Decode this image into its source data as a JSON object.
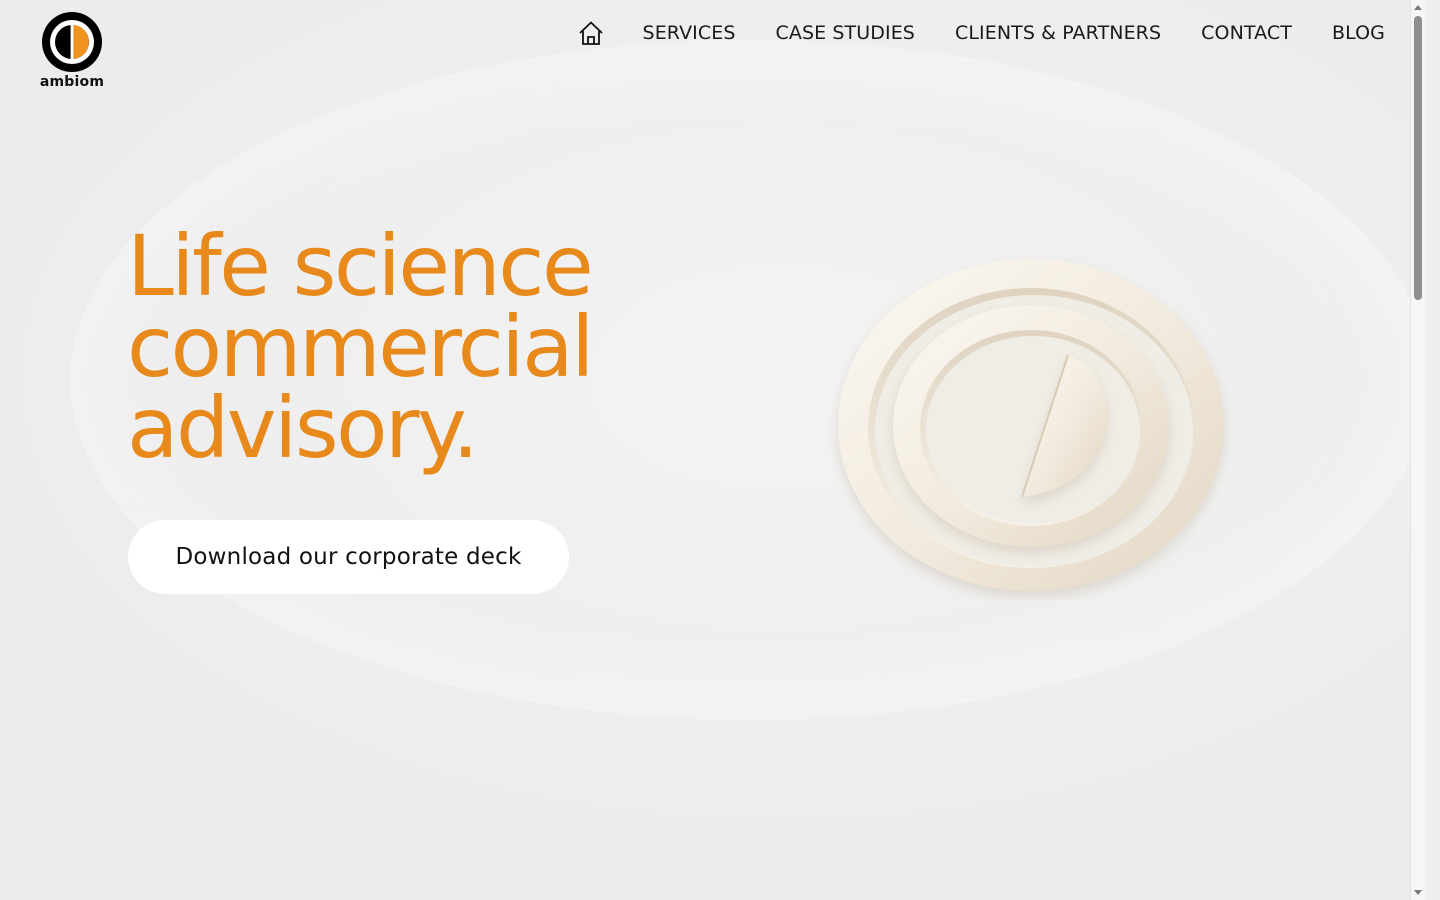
{
  "brand": {
    "name": "ambiom",
    "accent_color": "#e8891c",
    "logo_icon": "half-filled-circle-icon"
  },
  "nav": {
    "home_icon": "home-icon",
    "items": [
      {
        "label": "SERVICES"
      },
      {
        "label": "CASE STUDIES"
      },
      {
        "label": "CLIENTS & PARTNERS"
      },
      {
        "label": "CONTACT"
      },
      {
        "label": "BLOG"
      }
    ]
  },
  "hero": {
    "title_lines": [
      "Life science",
      "commercial",
      "advisory."
    ],
    "cta_label": "Download our corporate deck",
    "emblem_icon": "embossed-ambiom-emblem"
  }
}
